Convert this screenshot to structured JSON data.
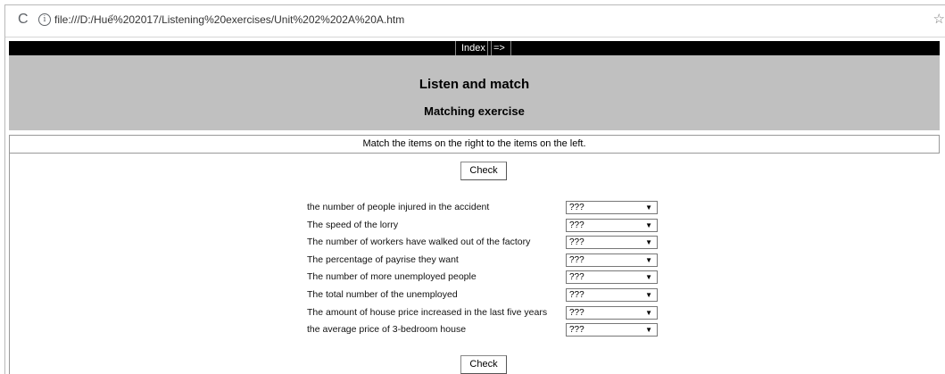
{
  "browser": {
    "url": "file:///D:/Huế%202017/Listening%20exercises/Unit%202%202A%20A.htm"
  },
  "nav": {
    "index_label": "Index",
    "next_label": "=>"
  },
  "header": {
    "title": "Listen and match",
    "subtitle": "Matching exercise"
  },
  "instructions": "Match the items on the right to the items on the left.",
  "check_label": "Check",
  "items": [
    {
      "label": "the number of people injured in the accident",
      "value": "???"
    },
    {
      "label": "The speed of the lorry",
      "value": "???"
    },
    {
      "label": "The number of workers have walked out of the factory",
      "value": "???"
    },
    {
      "label": "The percentage of payrise they want",
      "value": "???"
    },
    {
      "label": "The number of more unemployed people",
      "value": "???"
    },
    {
      "label": "The total number of the unemployed",
      "value": "???"
    },
    {
      "label": "The amount of house price increased in the last five years",
      "value": "???"
    },
    {
      "label": "the average price of 3-bedroom house",
      "value": "???"
    }
  ]
}
